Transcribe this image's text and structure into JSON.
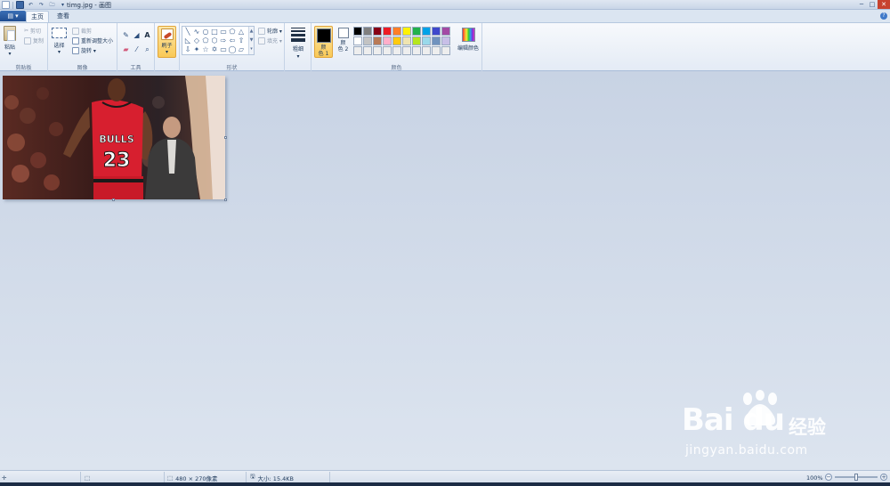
{
  "window": {
    "title": "timg.jpg - 画图",
    "minimize": "─",
    "maximize": "□",
    "close": "✕"
  },
  "qat": {
    "customize": "▾"
  },
  "tabs": {
    "app_menu": "▤ ▾",
    "home": "主页",
    "view": "查看",
    "help": "?"
  },
  "ribbon": {
    "clipboard": {
      "label": "剪贴板",
      "paste": "粘贴",
      "paste_arrow": "▾",
      "cut": "剪切",
      "copy": "复制"
    },
    "image": {
      "label": "图像",
      "select": "选择",
      "select_arrow": "▾",
      "crop": "裁剪",
      "resize": "重新调整大小",
      "rotate": "旋转 ▾"
    },
    "tools": {
      "label": "工具"
    },
    "brushes": {
      "label": "刷子",
      "arrow": "▾"
    },
    "shapes": {
      "label": "形状",
      "outline": "轮廓 ▾",
      "fill": "填充 ▾",
      "glyphs": [
        "╲",
        "∿",
        "○",
        "□",
        "▭",
        "⬠",
        "△",
        "◺",
        "◇",
        "⬠",
        "⬡",
        "⇨",
        "⇦",
        "⇧",
        "⇩",
        "✦",
        "☆",
        "✡",
        "▭",
        "◯",
        "▱"
      ]
    },
    "size": {
      "label": "粗细",
      "arrow": "▾"
    },
    "colors": {
      "label": "颜色",
      "color1": "颜\n色 1",
      "color2": "颜\n色 2",
      "edit_colors": "编辑颜色",
      "color1_value": "#000000",
      "color2_value": "#ffffff",
      "palette": [
        "#000000",
        "#7f7f7f",
        "#880015",
        "#ed1c24",
        "#ff7f27",
        "#fff200",
        "#22b14c",
        "#00a2e8",
        "#3f48cc",
        "#a349a4",
        "#ffffff",
        "#c3c3c3",
        "#b97a57",
        "#ffaec9",
        "#ffc90e",
        "#efe4b0",
        "#b5e61d",
        "#99d9ea",
        "#7092be",
        "#c8bfe7",
        "#eeeeee",
        "#eeeeee",
        "#eeeeee",
        "#eeeeee",
        "#eeeeee",
        "#eeeeee",
        "#eeeeee",
        "#eeeeee",
        "#eeeeee",
        "#eeeeee"
      ]
    }
  },
  "image": {
    "jersey_team": "BULLS",
    "jersey_number": "23"
  },
  "status": {
    "dimensions": "480 × 270像素",
    "file_size": "大小: 15.4KB",
    "zoom": "100%"
  },
  "watermark": {
    "logo": "Bai du",
    "brand": "经验",
    "url": "jingyan.baidu.com"
  }
}
